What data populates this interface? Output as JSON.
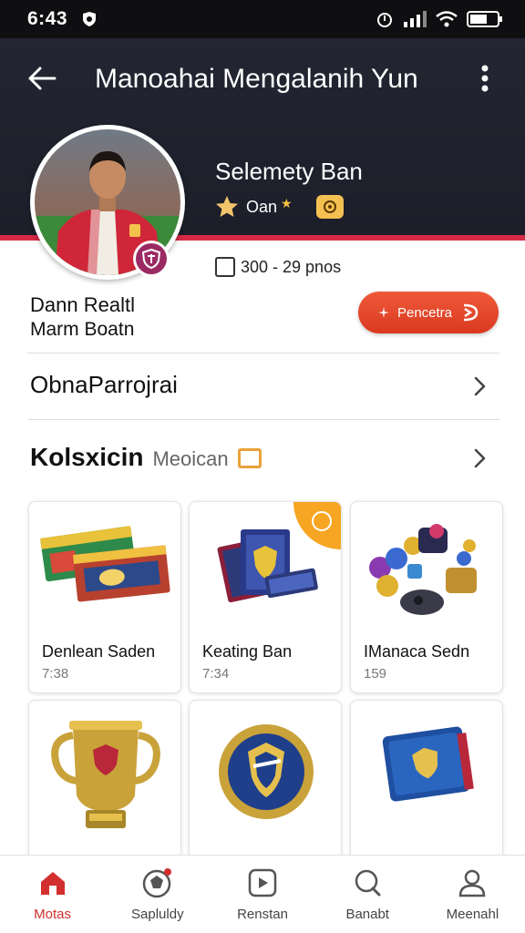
{
  "status_bar": {
    "time": "6:43"
  },
  "header": {
    "title": "Manoahai Mengalanih Yun"
  },
  "profile": {
    "name": "Selemety Ban",
    "level_label": "Oan",
    "points_text": "300 - 29 pnos",
    "username_line1": "Dann Realtl",
    "username_line2": "Marm Boatn",
    "action_button_label": "Pencetra"
  },
  "rows": {
    "first_row_label": "ObnaParrojrai"
  },
  "collection": {
    "title": "Kolsxicin",
    "subtitle": "Meoican"
  },
  "cards": [
    {
      "name": "Denlean Saden",
      "meta": "7:38"
    },
    {
      "name": "Keating Ban",
      "meta": "7:34"
    },
    {
      "name": "IManaca Sedn",
      "meta": "159"
    },
    {
      "name": "",
      "meta": ""
    },
    {
      "name": "",
      "meta": ""
    },
    {
      "name": "",
      "meta": ""
    }
  ],
  "bottom_nav": [
    {
      "label": "Motas",
      "icon": "home-icon",
      "active": true
    },
    {
      "label": "Sapluldy",
      "icon": "sports-icon",
      "active": false
    },
    {
      "label": "Renstan",
      "icon": "play-icon",
      "active": false
    },
    {
      "label": "Banabt",
      "icon": "search-icon",
      "active": false
    },
    {
      "label": "Meenahl",
      "icon": "profile-icon",
      "active": false
    }
  ],
  "colors": {
    "header_bg": "#232532",
    "accent": "#d62a47",
    "button": "#e8472b",
    "active_nav": "#d32f2f",
    "card_corner": "#f6a623"
  }
}
